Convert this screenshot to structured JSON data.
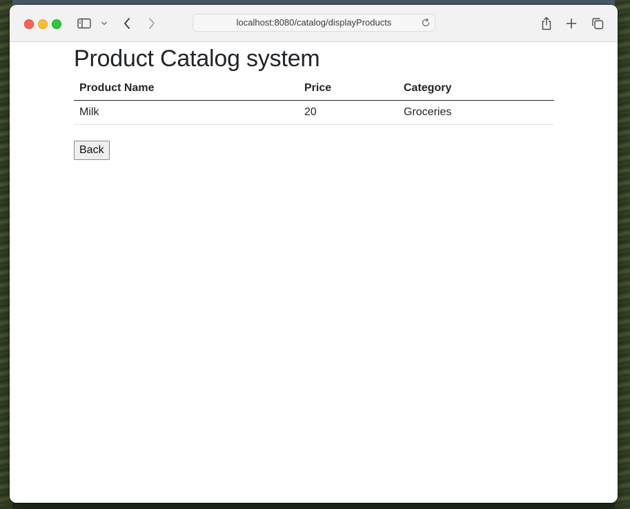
{
  "browser": {
    "url": "localhost:8080/catalog/displayProducts",
    "icons": {
      "sidebar": "sidebar-icon",
      "tab_menu": "chevron-down-icon",
      "back": "chevron-left-icon",
      "forward": "chevron-right-icon",
      "reload": "reload-icon",
      "share": "share-icon",
      "new_tab": "plus-icon",
      "tab_overview": "tabs-icon"
    }
  },
  "page": {
    "title": "Product Catalog system",
    "table": {
      "headers": [
        "Product Name",
        "Price",
        "Category"
      ],
      "rows": [
        [
          "Milk",
          "20",
          "Groceries"
        ]
      ]
    },
    "back_label": "Back"
  },
  "colors": {
    "text": "#212529",
    "traffic_red": "#fe5f57",
    "traffic_yellow": "#febc2e",
    "traffic_green": "#28c840"
  }
}
